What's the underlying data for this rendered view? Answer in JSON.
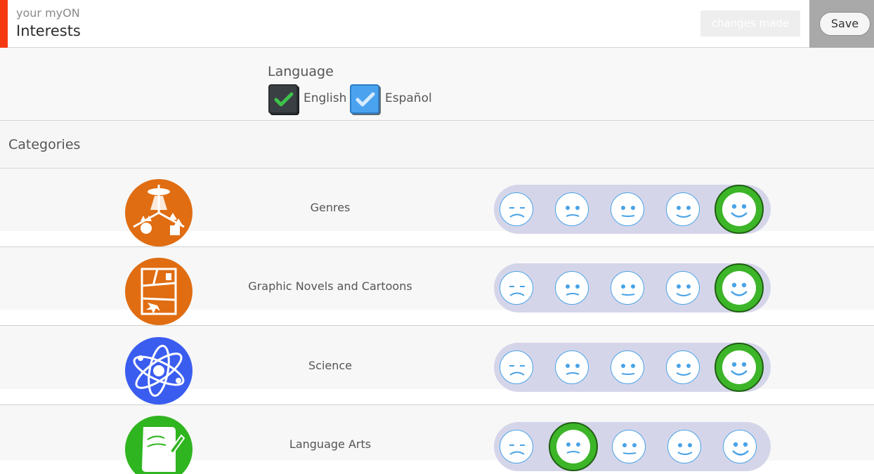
{
  "header": {
    "subtitle": "your myON",
    "title": "Interests",
    "changes_label": "changes made",
    "save_label": "Save"
  },
  "language": {
    "title": "Language",
    "options": [
      {
        "label": "English",
        "checked": true,
        "color": "#3a3f44"
      },
      {
        "label": "Español",
        "checked": true,
        "color": "#4ba3f0"
      }
    ]
  },
  "categories": {
    "title": "Categories",
    "items": [
      {
        "label": "Genres",
        "icon": "genres-icon",
        "icon_color": "#e06d12",
        "rating": 5
      },
      {
        "label": "Graphic Novels and Cartoons",
        "icon": "graphic-novels-icon",
        "icon_color": "#e06d12",
        "rating": 5
      },
      {
        "label": "Science",
        "icon": "science-atom-icon",
        "icon_color": "#3a5df0",
        "rating": 5
      },
      {
        "label": "Language Arts",
        "icon": "language-arts-scroll-icon",
        "icon_color": "#2fb51f",
        "rating": 2
      }
    ]
  },
  "colors": {
    "accent": "#f53a12",
    "face_border": "#4aa3e6",
    "face_selected": "#3cb528",
    "track": "#d5d5ea"
  }
}
